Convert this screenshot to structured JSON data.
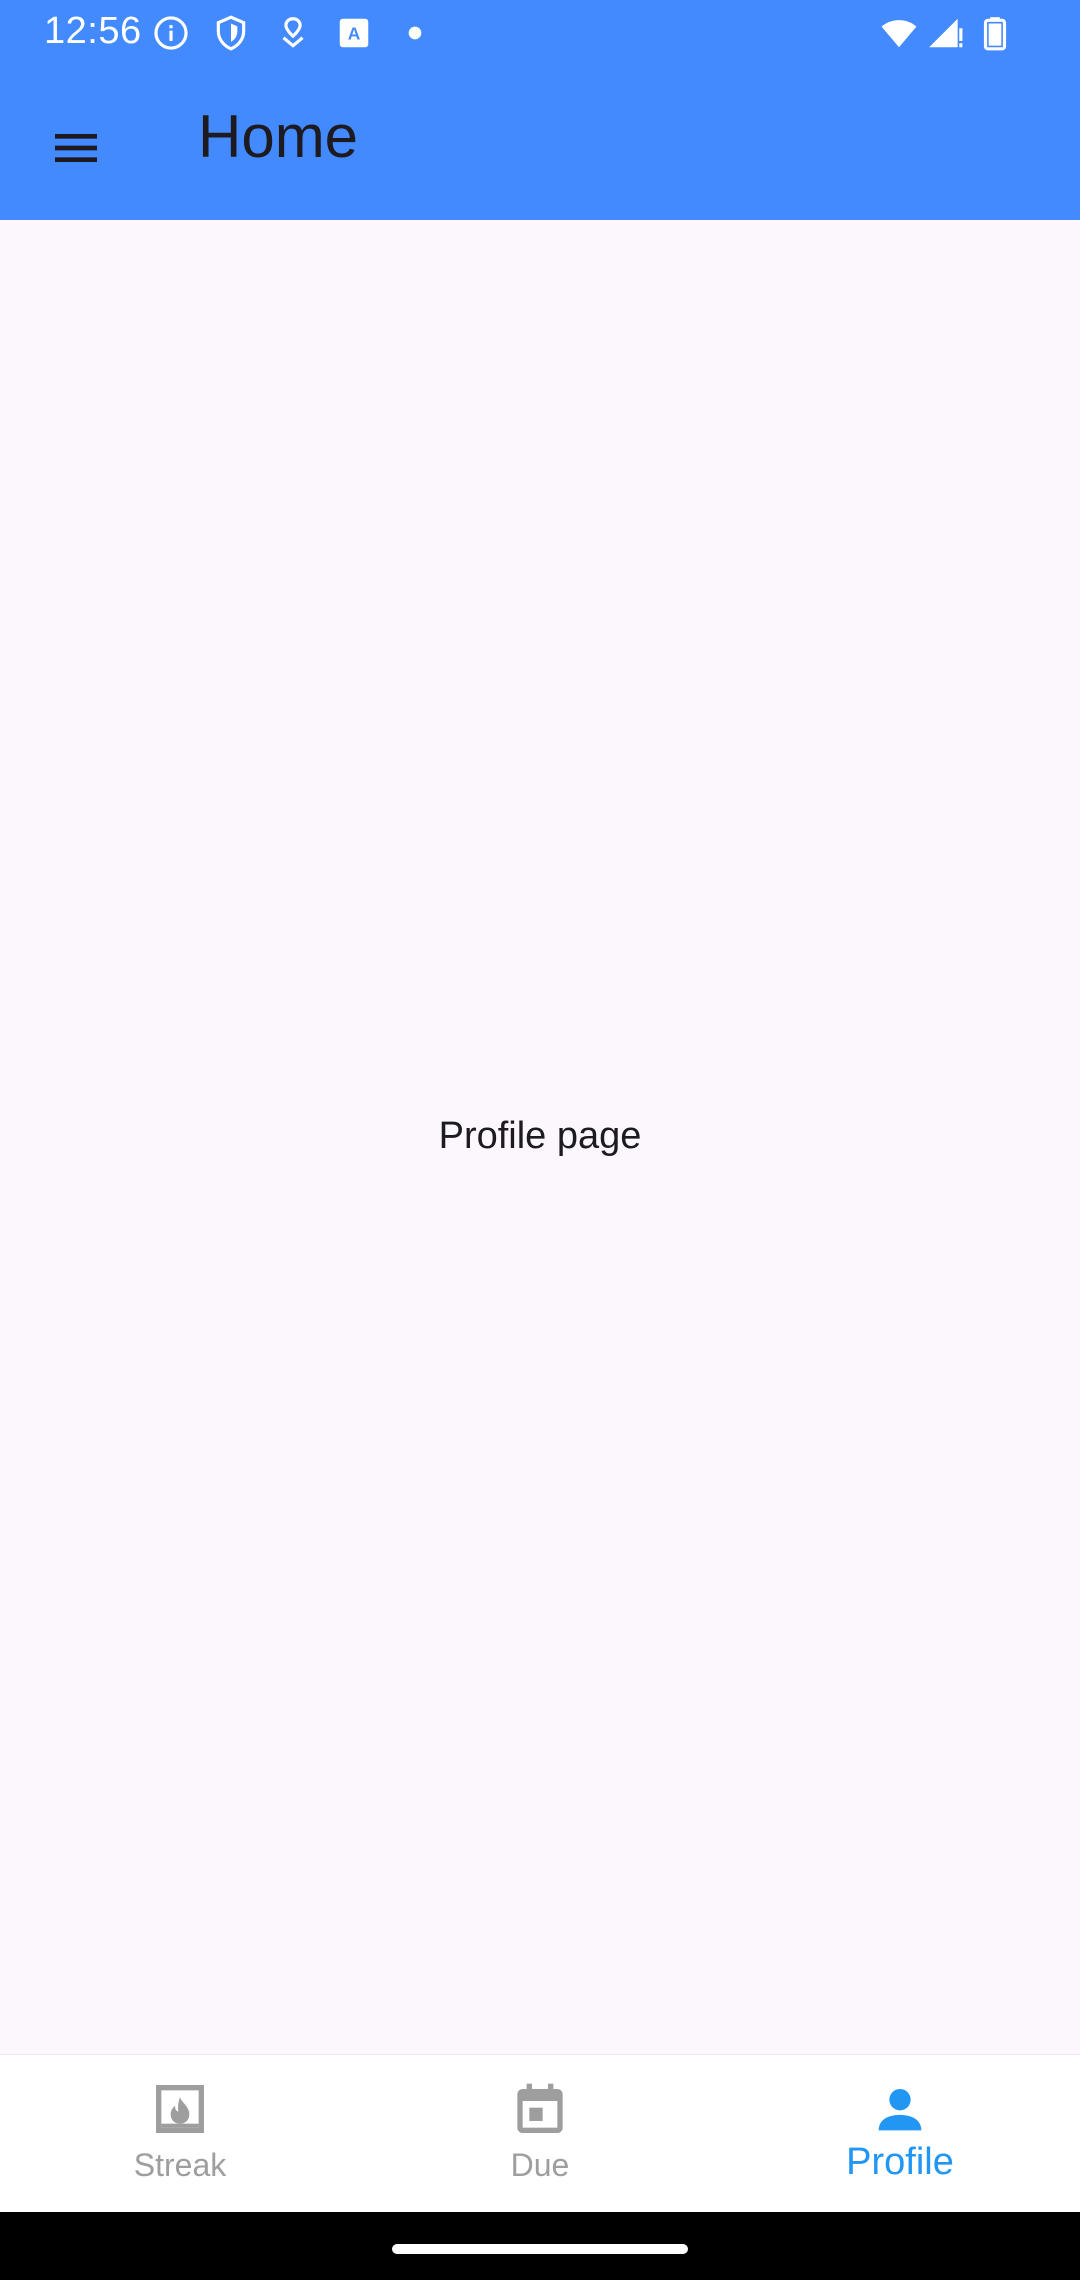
{
  "status_bar": {
    "time": "12:56",
    "icons": [
      "info-icon",
      "shield-icon",
      "location-pin-icon",
      "keyboard-a-icon",
      "dot-icon",
      "wifi-icon",
      "signal-icon",
      "battery-icon"
    ]
  },
  "app_bar": {
    "title": "Home",
    "menu_icon": "menu-icon",
    "color": "#448AFF"
  },
  "content": {
    "text": "Profile page"
  },
  "bottom_nav": {
    "items": [
      {
        "label": "Streak",
        "icon": "fireplace-icon",
        "active": false
      },
      {
        "label": "Due",
        "icon": "calendar-icon",
        "active": false
      },
      {
        "label": "Profile",
        "icon": "person-icon",
        "active": true
      }
    ],
    "active_color": "#2196F3",
    "inactive_color": "#9E9E9E"
  }
}
